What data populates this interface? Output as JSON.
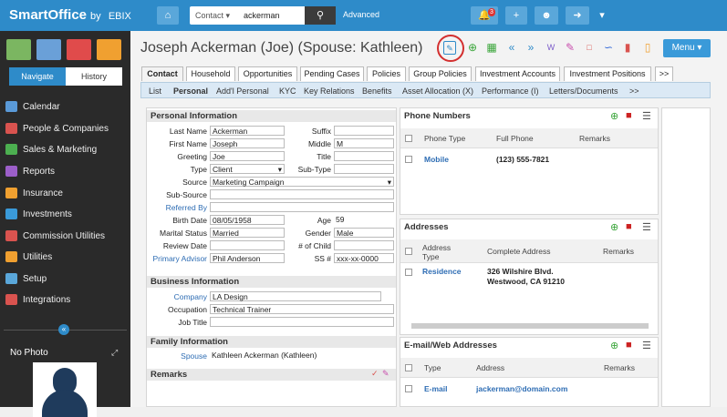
{
  "app": {
    "brand": "SmartOffice",
    "by": "by",
    "ebix": "EBIX"
  },
  "search": {
    "type": "Contact",
    "value": "ackerman",
    "advanced": "Advanced",
    "notif_count": "3"
  },
  "sidebar": {
    "tabs": [
      "Navigate",
      "History"
    ],
    "items": [
      "Calendar",
      "People & Companies",
      "Sales & Marketing",
      "Reports",
      "Insurance",
      "Investments",
      "Commission Utilities",
      "Utilities",
      "Setup",
      "Integrations"
    ],
    "no_photo": "No Photo"
  },
  "contact": {
    "title": "Joseph Ackerman (Joe) (Spouse: Kathleen)",
    "menu": "Menu"
  },
  "tabs": [
    "Contact",
    "Household",
    "Opportunities",
    "Pending Cases",
    "Policies",
    "Group Policies",
    "Investment Accounts",
    "Investment Positions",
    ">>"
  ],
  "subnav": [
    "List",
    "Personal",
    "Add'l Personal",
    "KYC",
    "Key Relations",
    "Benefits",
    "Asset Allocation (X)",
    "Performance (I)",
    "Letters/Documents",
    ">>"
  ],
  "personal": {
    "heading": "Personal Information",
    "last_name_label": "Last Name",
    "last_name": "Ackerman",
    "first_name_label": "First Name",
    "first_name": "Joseph",
    "greeting_label": "Greeting",
    "greeting": "Joe",
    "type_label": "Type",
    "type": "Client",
    "source_label": "Source",
    "source": "Marketing Campaign",
    "subsource_label": "Sub-Source",
    "referred_label": "Referred By",
    "birth_label": "Birth Date",
    "birth": "08/05/1958",
    "marital_label": "Marital Status",
    "marital": "Married",
    "review_label": "Review Date",
    "advisor_label": "Primary Advisor",
    "advisor": "Phil Anderson",
    "suffix_label": "Suffix",
    "middle_label": "Middle",
    "middle": "M",
    "title_label": "Title",
    "subtype_label": "Sub-Type",
    "age_label": "Age",
    "age": "59",
    "gender_label": "Gender",
    "gender": "Male",
    "children_label": "# of Child",
    "ssn_label": "SS #",
    "ssn": "xxx-xx-0000"
  },
  "business": {
    "heading": "Business Information",
    "company_label": "Company",
    "company": "LA Design",
    "occupation_label": "Occupation",
    "occupation": "Technical Trainer",
    "job_label": "Job Title"
  },
  "family": {
    "heading": "Family Information",
    "spouse_label": "Spouse",
    "spouse": "Kathleen Ackerman  (Kathleen)"
  },
  "remarks": {
    "heading": "Remarks"
  },
  "phones": {
    "heading": "Phone Numbers",
    "cols": [
      "Phone Type",
      "Full Phone",
      "Remarks"
    ],
    "rows": [
      {
        "type": "Mobile",
        "number": "(123) 555-7821"
      }
    ]
  },
  "addresses": {
    "heading": "Addresses",
    "cols": [
      "Address Type",
      "Complete Address",
      "Remarks"
    ],
    "rows": [
      {
        "type": "Residence",
        "line1": "326 Wilshire Blvd.",
        "line2": "Westwood, CA 91210"
      }
    ]
  },
  "emails": {
    "heading": "E-mail/Web Addresses",
    "cols": [
      "Type",
      "Address",
      "Remarks"
    ],
    "rows": [
      {
        "type": "E-mail",
        "address": "jackerman@domain.com"
      }
    ]
  },
  "colors": {
    "brand": "#2e8bc9",
    "link": "#2e6db4",
    "add": "#3aa53a",
    "delete": "#cc2222",
    "highlight_circle": "#d32f2f"
  }
}
